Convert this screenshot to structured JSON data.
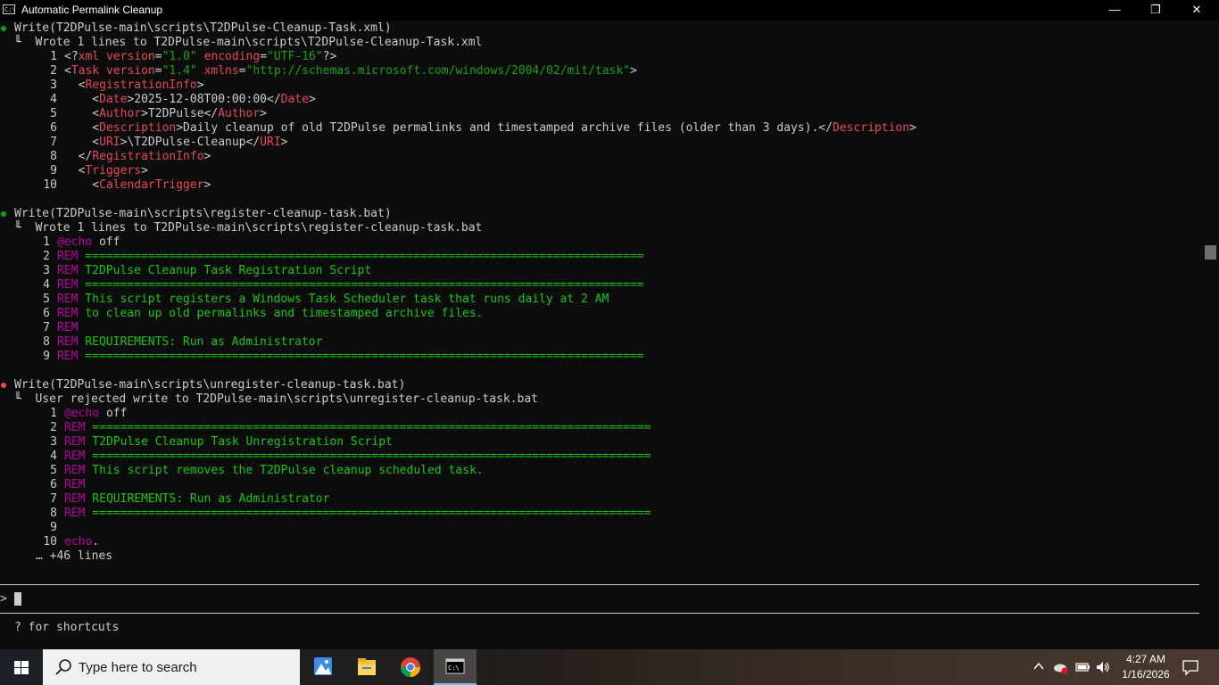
{
  "window": {
    "title": "Automatic Permalink Cleanup",
    "minimize_glyph": "—",
    "restore_glyph": "❐",
    "close_glyph": "✕",
    "icon_text": "C:\\"
  },
  "colors": {
    "success_bullet": "#13a10e",
    "rejected_bullet": "#e74856",
    "xml_tag": "#e74856",
    "string": "#13a10e",
    "rem_keyword": "#b4009e",
    "rem_text": "#16c60c"
  },
  "blocks": [
    {
      "status": "success",
      "header": "Write(T2DPulse-main\\scripts\\T2DPulse-Cleanup-Task.xml)",
      "result": "╙  Wrote 1 lines to T2DPulse-main\\scripts\\T2DPulse-Cleanup-Task.xml",
      "lines": [
        {
          "n": "1",
          "seg": [
            [
              "def",
              "<?"
            ],
            [
              "tag",
              "xml"
            ],
            [
              "def",
              " "
            ],
            [
              "tag",
              "version"
            ],
            [
              "def",
              "="
            ],
            [
              "str",
              "\"1.0\""
            ],
            [
              "def",
              " "
            ],
            [
              "tag",
              "encoding"
            ],
            [
              "def",
              "="
            ],
            [
              "str",
              "\"UTF-16\""
            ],
            [
              "def",
              "?>"
            ]
          ]
        },
        {
          "n": "2",
          "seg": [
            [
              "def",
              "<"
            ],
            [
              "tag",
              "Task"
            ],
            [
              "def",
              " "
            ],
            [
              "tag",
              "version"
            ],
            [
              "def",
              "="
            ],
            [
              "str",
              "\"1.4\""
            ],
            [
              "def",
              " "
            ],
            [
              "tag",
              "xmlns"
            ],
            [
              "def",
              "="
            ],
            [
              "str",
              "\"http://schemas.microsoft.com/windows/2004/02/mit/task\""
            ],
            [
              "def",
              ">"
            ]
          ]
        },
        {
          "n": "3",
          "seg": [
            [
              "def",
              "  <"
            ],
            [
              "tag",
              "RegistrationInfo"
            ],
            [
              "def",
              ">"
            ]
          ]
        },
        {
          "n": "4",
          "seg": [
            [
              "def",
              "    <"
            ],
            [
              "tag",
              "Date"
            ],
            [
              "def",
              ">2025-12-08T00:00:00</"
            ],
            [
              "tag",
              "Date"
            ],
            [
              "def",
              ">"
            ]
          ]
        },
        {
          "n": "5",
          "seg": [
            [
              "def",
              "    <"
            ],
            [
              "tag",
              "Author"
            ],
            [
              "def",
              ">T2DPulse</"
            ],
            [
              "tag",
              "Author"
            ],
            [
              "def",
              ">"
            ]
          ]
        },
        {
          "n": "6",
          "seg": [
            [
              "def",
              "    <"
            ],
            [
              "tag",
              "Description"
            ],
            [
              "def",
              ">Daily cleanup of old T2DPulse permalinks and timestamped archive files (older than 3 days).</"
            ],
            [
              "tag",
              "Description"
            ],
            [
              "def",
              ">"
            ]
          ]
        },
        {
          "n": "7",
          "seg": [
            [
              "def",
              "    <"
            ],
            [
              "tag",
              "URI"
            ],
            [
              "def",
              ">\\T2DPulse-Cleanup</"
            ],
            [
              "tag",
              "URI"
            ],
            [
              "def",
              ">"
            ]
          ]
        },
        {
          "n": "8",
          "seg": [
            [
              "def",
              "  </"
            ],
            [
              "tag",
              "RegistrationInfo"
            ],
            [
              "def",
              ">"
            ]
          ]
        },
        {
          "n": "9",
          "seg": [
            [
              "def",
              "  <"
            ],
            [
              "tag",
              "Triggers"
            ],
            [
              "def",
              ">"
            ]
          ]
        },
        {
          "n": "10",
          "seg": [
            [
              "def",
              "    <"
            ],
            [
              "tag",
              "CalendarTrigger"
            ],
            [
              "def",
              ">"
            ]
          ]
        }
      ]
    },
    {
      "status": "success",
      "header": "Write(T2DPulse-main\\scripts\\register-cleanup-task.bat)",
      "result": "╙  Wrote 1 lines to T2DPulse-main\\scripts\\register-cleanup-task.bat",
      "lines": [
        {
          "n": "1",
          "seg": [
            [
              "rem",
              "@echo"
            ],
            [
              "def",
              " off"
            ]
          ]
        },
        {
          "n": "2",
          "seg": [
            [
              "rem",
              "REM"
            ],
            [
              "rtext",
              " ================================================================================"
            ]
          ]
        },
        {
          "n": "3",
          "seg": [
            [
              "rem",
              "REM"
            ],
            [
              "rtext",
              " T2DPulse Cleanup Task Registration Script"
            ]
          ]
        },
        {
          "n": "4",
          "seg": [
            [
              "rem",
              "REM"
            ],
            [
              "rtext",
              " ================================================================================"
            ]
          ]
        },
        {
          "n": "5",
          "seg": [
            [
              "rem",
              "REM"
            ],
            [
              "rtext",
              " This script registers a Windows Task Scheduler task that runs daily at 2 AM"
            ]
          ]
        },
        {
          "n": "6",
          "seg": [
            [
              "rem",
              "REM"
            ],
            [
              "rtext",
              " to clean up old permalinks and timestamped archive files."
            ]
          ]
        },
        {
          "n": "7",
          "seg": [
            [
              "rem",
              "REM"
            ]
          ]
        },
        {
          "n": "8",
          "seg": [
            [
              "rem",
              "REM"
            ],
            [
              "rtext",
              " REQUIREMENTS: Run as Administrator"
            ]
          ]
        },
        {
          "n": "9",
          "seg": [
            [
              "rem",
              "REM"
            ],
            [
              "rtext",
              " ================================================================================"
            ]
          ]
        }
      ]
    },
    {
      "status": "rejected",
      "header": "Write(T2DPulse-main\\scripts\\unregister-cleanup-task.bat)",
      "result": "╙  User rejected write to T2DPulse-main\\scripts\\unregister-cleanup-task.bat",
      "lines": [
        {
          "n": "1",
          "seg": [
            [
              "rem",
              "@echo"
            ],
            [
              "def",
              " off"
            ]
          ]
        },
        {
          "n": "2",
          "seg": [
            [
              "rem",
              "REM"
            ],
            [
              "rtext",
              " ================================================================================"
            ]
          ]
        },
        {
          "n": "3",
          "seg": [
            [
              "rem",
              "REM"
            ],
            [
              "rtext",
              " T2DPulse Cleanup Task Unregistration Script"
            ]
          ]
        },
        {
          "n": "4",
          "seg": [
            [
              "rem",
              "REM"
            ],
            [
              "rtext",
              " ================================================================================"
            ]
          ]
        },
        {
          "n": "5",
          "seg": [
            [
              "rem",
              "REM"
            ],
            [
              "rtext",
              " This script removes the T2DPulse cleanup scheduled task."
            ]
          ]
        },
        {
          "n": "6",
          "seg": [
            [
              "rem",
              "REM"
            ]
          ]
        },
        {
          "n": "7",
          "seg": [
            [
              "rem",
              "REM"
            ],
            [
              "rtext",
              " REQUIREMENTS: Run as Administrator"
            ]
          ]
        },
        {
          "n": "8",
          "seg": [
            [
              "rem",
              "REM"
            ],
            [
              "rtext",
              " ================================================================================"
            ]
          ]
        },
        {
          "n": "9",
          "seg": []
        },
        {
          "n": "10",
          "seg": [
            [
              "rem",
              "echo"
            ],
            [
              "def",
              "."
            ]
          ]
        }
      ],
      "more": "… +46 lines"
    }
  ],
  "prompt": {
    "symbol": ">",
    "value": ""
  },
  "hint": "? for shortcuts",
  "taskbar": {
    "search_placeholder": "Type here to search",
    "apps": [
      "photos-app-icon",
      "file-explorer-icon",
      "chrome-icon",
      "terminal-icon"
    ],
    "time": "4:27 AM",
    "date": "1/16/2026"
  }
}
